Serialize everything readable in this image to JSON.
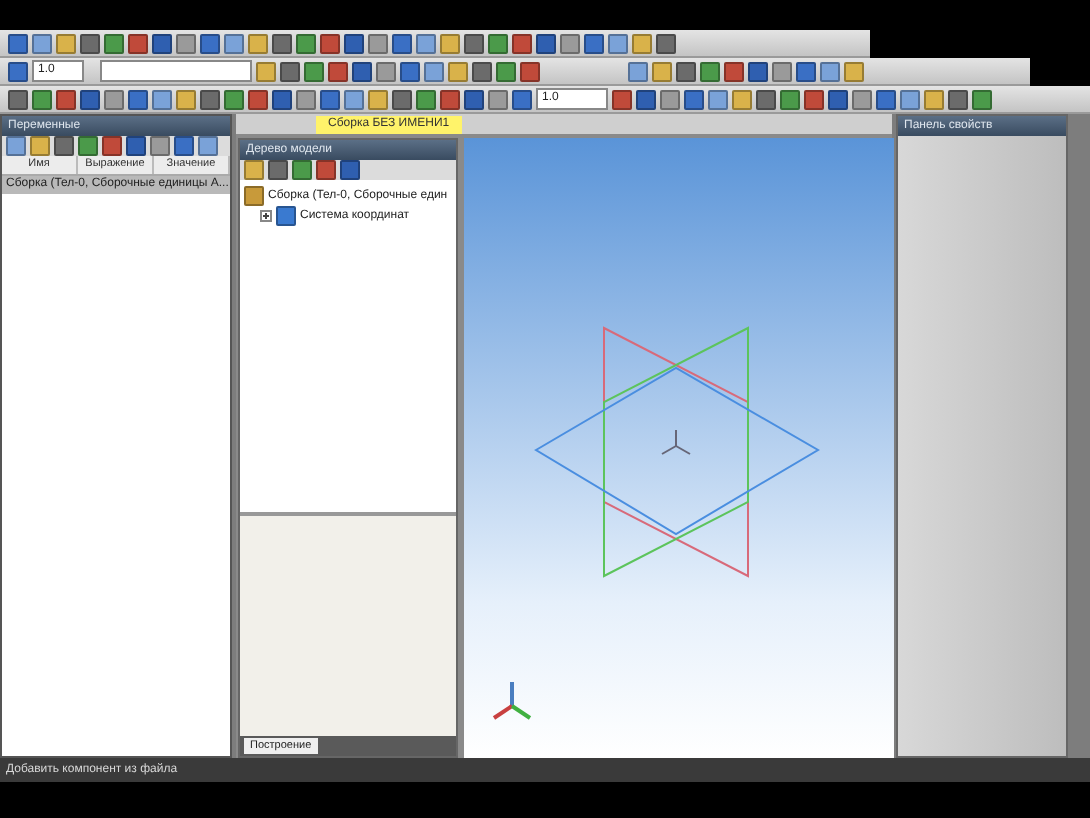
{
  "toolbar": {
    "scale_field": "1.0",
    "zoom_field": "1.0"
  },
  "variables_panel": {
    "title": "Переменные",
    "columns": [
      "Имя",
      "Выражение",
      "Значение"
    ],
    "rows": [
      {
        "text": "Сборка (Тел-0, Сборочные единицы А...",
        "selected": true
      }
    ]
  },
  "document": {
    "tab": {
      "label": "Сборка БЕЗ ИМЕНИ1",
      "selected": true
    },
    "tree": {
      "title": "Дерево модели",
      "items": [
        {
          "label": "Сборка (Тел-0, Сборочные един",
          "children": [
            {
              "label": "Система координат",
              "expanded": false
            }
          ]
        }
      ],
      "bottom_tab": {
        "label": "Построение",
        "selected": true
      }
    }
  },
  "properties_panel": {
    "title": "Панель свойств"
  },
  "status_bar": {
    "text": "Добавить компонент из файла"
  }
}
